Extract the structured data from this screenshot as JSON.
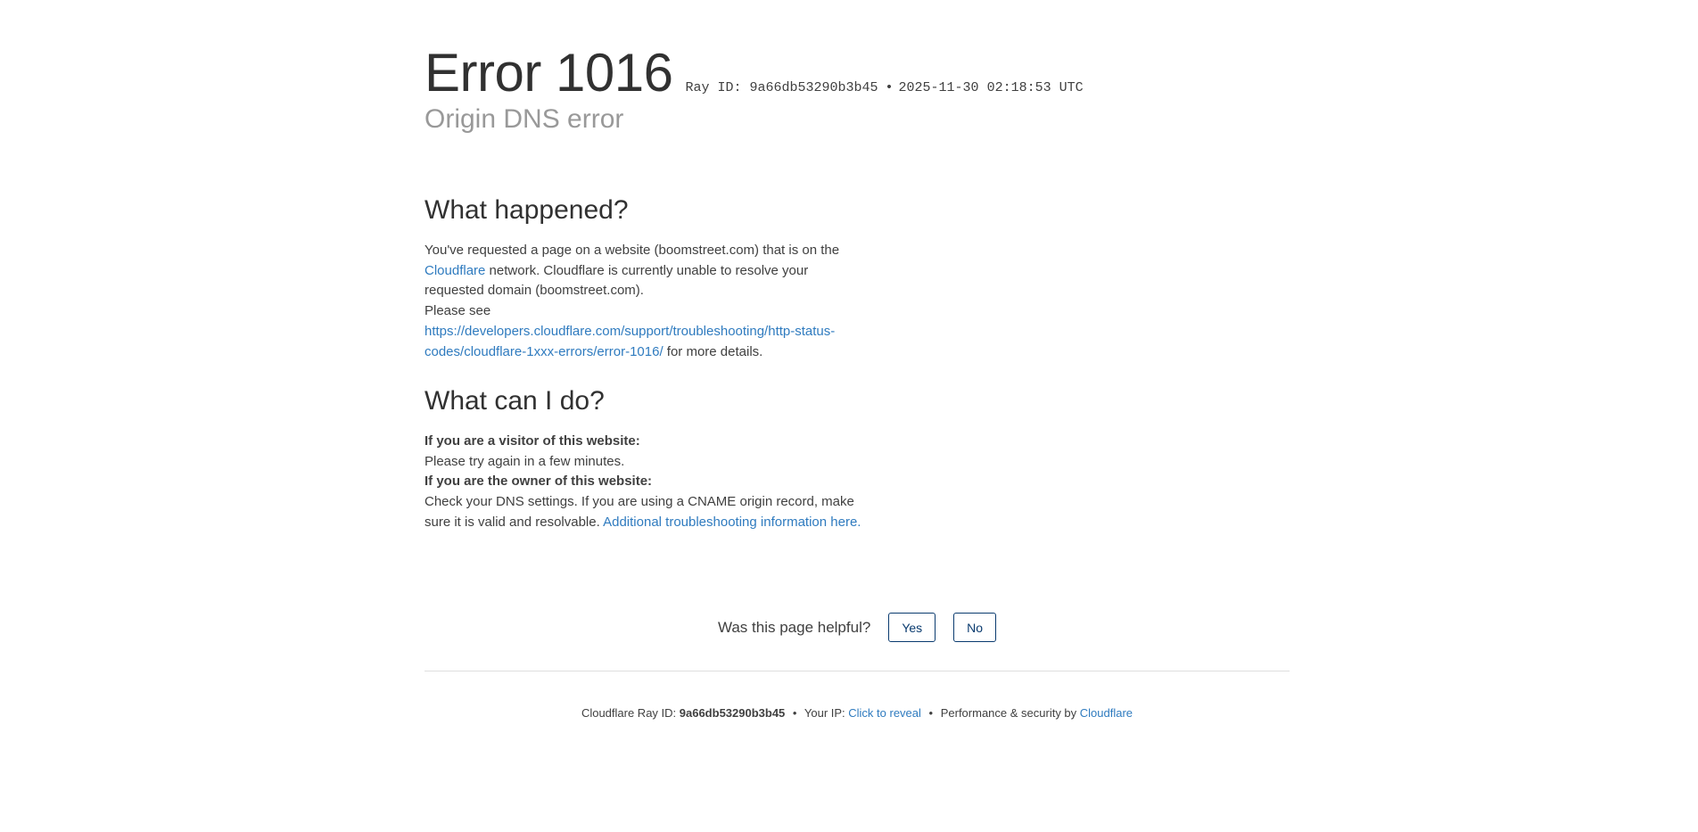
{
  "header": {
    "title": "Error 1016",
    "ray_label": "Ray ID: 9a66db53290b3b45",
    "bullet": "•",
    "timestamp": "2025-11-30 02:18:53 UTC",
    "subtitle": "Origin DNS error"
  },
  "what_happened": {
    "heading": "What happened?",
    "text_1": "You've requested a page on a website (boomstreet.com) that is on the ",
    "cloudflare_link": "Cloudflare",
    "text_2": " network. Cloudflare is currently unable to resolve your requested domain (boomstreet.com).",
    "please_see": "Please see",
    "docs_link": "https://developers.cloudflare.com/support/troubleshooting/http-status-codes/cloudflare-1xxx-errors/error-1016/",
    "text_3": " for more details."
  },
  "what_can_i_do": {
    "heading": "What can I do?",
    "visitor_label": "If you are a visitor of this website:",
    "visitor_text": "Please try again in a few minutes.",
    "owner_label": "If you are the owner of this website:",
    "owner_text": "Check your DNS settings. If you are using a CNAME origin record, make sure it is valid and resolvable. ",
    "owner_link": "Additional troubleshooting information here."
  },
  "feedback": {
    "question": "Was this page helpful?",
    "yes_label": "Yes",
    "no_label": "No"
  },
  "footer": {
    "ray_prefix": "Cloudflare Ray ID: ",
    "ray_id": "9a66db53290b3b45",
    "bullet": "•",
    "ip_prefix": "Your IP: ",
    "ip_reveal": "Click to reveal",
    "perf_text": "Performance & security by ",
    "cloudflare_link": "Cloudflare"
  },
  "colors": {
    "link": "#2f7bbf",
    "button_border": "#0a3b6f",
    "subtitle": "#999999",
    "text": "#404040"
  }
}
